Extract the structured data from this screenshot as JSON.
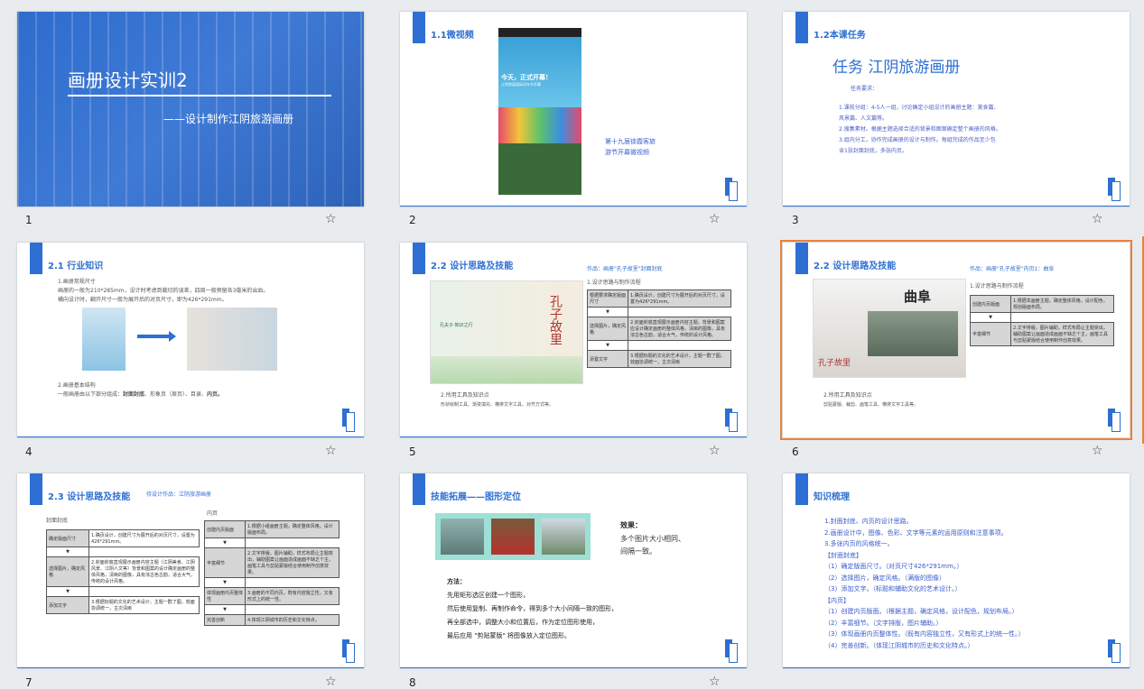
{
  "slides": [
    {
      "num": "1",
      "title": "画册设计实训2",
      "subtitle": "——设计制作江阴旅游画册"
    },
    {
      "num": "2",
      "title": "1.1微视频",
      "caption_line1": "第十九届徐霞客旅",
      "caption_line2": "游节开幕微视频",
      "phone_banner": "今天，正式开幕！",
      "phone_sub": "江阴首届国际风车节开幕"
    },
    {
      "num": "3",
      "title": "1.2本课任务",
      "heading": "任务  江阴旅游画册",
      "req_label": "任务要求：",
      "req_lines": [
        "1.课前分组：4-5人一组，讨论确定小组设计的画册主题：美食篇、",
        "风景篇、人文篇等。",
        "2.搜集素材。根据主题选择合适的背景和图案确定整个画册的风格。",
        "3.组内分工，协作完成画册的设计与制作。每组完成的作品至少包",
        "含1张封面封底，多张内页。"
      ]
    },
    {
      "num": "4",
      "title": "2.1 行业知识",
      "p1": "1.画册常规尺寸",
      "p2": "画册的一般为210*285mm，设计时考虑到裁切的误差，四周一般预留各3毫米的出血。",
      "p3": "横向设计时，翻开尺寸一般为展开后的对页尺寸，即为426*291mm。",
      "p4": "2.画册基本结构",
      "p5a": "一般画册由以下部分组成：",
      "p5b": "封面封底",
      "p5c": "、形象页（扉页）、目录、",
      "p5d": "内页。"
    },
    {
      "num": "5",
      "title": "2.2 设计思路及技能",
      "work": "作品：画册\"孔子故里\"封面封底",
      "flow_title": "1.设计思路与制作流程",
      "rows": [
        [
          "根据要求确定版面尺寸",
          "1.确页设计，创建尺寸为展开后的对页尺寸，设置为426*291mm。"
        ],
        [
          "选择图片，确定风格",
          "2.封面封底直观展示画册内容主题，背景和图案应设计确定画册的整体风格，清晰的图像，具有浓古色古韵，适合大气，传统的设计风格。"
        ],
        [
          "添置文字",
          "3.根据标题的文化的艺术设计，主题一群了图，效面协调统一，主次清晰"
        ]
      ],
      "tools_title": "2.所用工具及知识点",
      "tools": "形状绘制工具、渐变填充、横排文字工具、对齐方式等。",
      "book_a": "孔子故里",
      "book_b": "孔夫子·知识之行"
    },
    {
      "num": "6",
      "title": "2.2 设计思路及技能",
      "work": "作品：画册\"孔子故里\"内页1：曲阜",
      "flow_title": "1.设计思路与制作流程",
      "rows": [
        [
          "创建内页版面",
          "1.根据本画册主题，确定整体风格，设计配色，规划版面布局。"
        ],
        [
          "丰富细节",
          "2.文字排版，图片辅助，样式布局让主题突出，辅助图案让画面造成画面不缺乏个主，画笔工具与剪贴蒙版结合使用制作创意效果。"
        ]
      ],
      "tools_title": "2.所用工具及知识点",
      "tools": "剪贴蒙版、裁剪、画笔工具、横排文字工具等。",
      "logo": "曲阜",
      "sign": "孔子故里"
    },
    {
      "num": "7",
      "title": "2.3 设计思路及技能",
      "work": "待设计作品：江阴旅游画册",
      "left_label": "封面封底",
      "right_label": "内页",
      "left_rows": [
        [
          "确定版面尺寸",
          "1.确页设计，创建尺寸为展开后的对页尺寸，设置为426*291mm。"
        ],
        [
          "选择图片，确定风格",
          "2.封面封底直观展示画册内容主题（江阴美食、江阴风景、江阴人文等）背景和图案的设计确定画册的整体风格，清晰的图像，具有浓古色古韵，适合大气，传统的设计风格。"
        ],
        [
          "添加文字",
          "3.根据标题的文化的艺术设计，主题一群了图，效面协调统一，主次清晰"
        ]
      ],
      "right_rows": [
        [
          "创建内页版面",
          "1.根据小组画册主题，确定整体风格，设计版面布局。"
        ],
        [
          "丰富细节",
          "2.文字排版，图片辅助，样式布局让主题突出，辅助图案让画面造成画面不缺乏个主，画笔工具与剪贴蒙版结合使用制作创意效果。"
        ],
        [
          "体现画册内页整体性",
          "3.画册的不同内页，既有内容独立性，又有形式上的统一性。"
        ],
        [
          "完善创新",
          "4.体现江阴城市的历史和文化特点。"
        ]
      ]
    },
    {
      "num": "8",
      "title": "技能拓展——图形定位",
      "effect_label": "效果：",
      "effect1": "多个图片大小相同、",
      "effect2": "间隔一致。",
      "method_label": "方法：",
      "m1": "先用矩形选区创建一个图形，",
      "m2": "然后使用复制、再制作命令，得到多个大小间隔一致的图形，",
      "m3": "再全部选中，调整大小和位置后，作为定位图形使用，",
      "m4": "最后应用 \"剪贴蒙版\" 将图像放入定位图形。"
    },
    {
      "num": "9",
      "title": "知识梳理",
      "lines": [
        "1.封面封底、内页的设计思路。",
        "2.画册设计中，图像、色彩、文字等元素的运用原则和注意事项。",
        "3.多张内页的风格统一。",
        "【封面封底】",
        "（1）确定版面尺寸。（对页尺寸426*291mm。）",
        "（2）选择图片，确定风格。（满版的图像）",
        "（3）添加文字。（标题和辅助文化的艺术设计。）",
        "【内页】",
        "（1）创建内页版面。（根据主题，确定风格，设计配色，规划布局。）",
        "（2）丰富细节。（文字排版，图片辅助。）",
        "（3）体现画册内页整体性。（既有内容独立性，又有形式上的统一性。）",
        "（4）完善创新。（体现江阴城市的历史和文化特点。）"
      ]
    }
  ],
  "colors": {
    "accent": "#2d6fd2",
    "selected": "#e8823c"
  }
}
